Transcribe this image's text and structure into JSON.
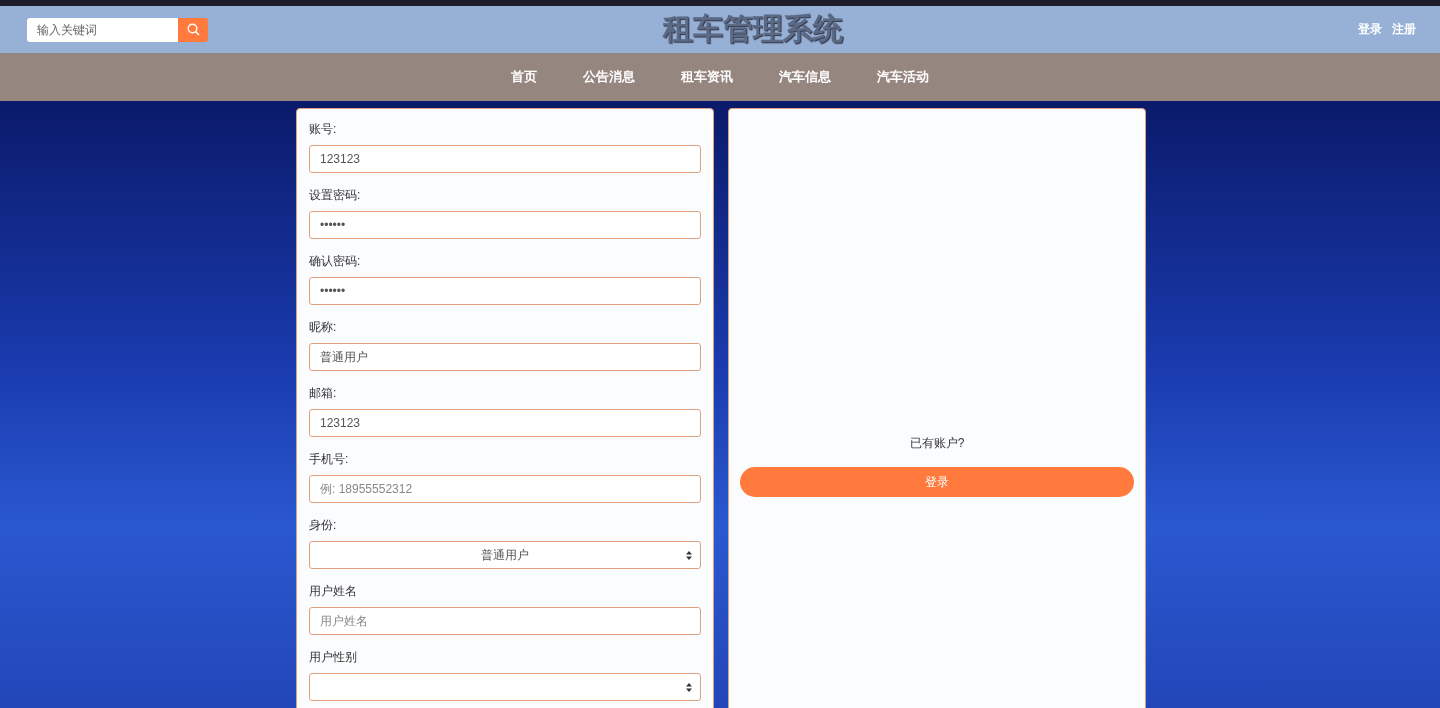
{
  "header": {
    "search": {
      "placeholder": "输入关键词"
    },
    "title": "租车管理系统",
    "links": [
      "登录",
      "注册"
    ]
  },
  "nav": [
    "首页",
    "公告消息",
    "租车资讯",
    "汽车信息",
    "汽车活动"
  ],
  "form": {
    "fields": [
      {
        "kind": "text",
        "label": "账号:",
        "value": "123123"
      },
      {
        "kind": "text",
        "label": "设置密码:",
        "value": "••••••"
      },
      {
        "kind": "text",
        "label": "确认密码:",
        "value": "••••••"
      },
      {
        "kind": "text",
        "label": "昵称:",
        "value": "普通用户"
      },
      {
        "kind": "text",
        "label": "邮箱:",
        "value": "123123"
      },
      {
        "kind": "text",
        "label": "手机号:",
        "placeholder": "例: 18955552312"
      },
      {
        "kind": "select",
        "label": "身份:",
        "value": "普通用户"
      },
      {
        "kind": "text",
        "label": "用户姓名",
        "placeholder": "用户姓名"
      },
      {
        "kind": "select",
        "label": "用户性别"
      }
    ]
  },
  "side": {
    "prompt": "已有账户?",
    "button": "登录"
  }
}
